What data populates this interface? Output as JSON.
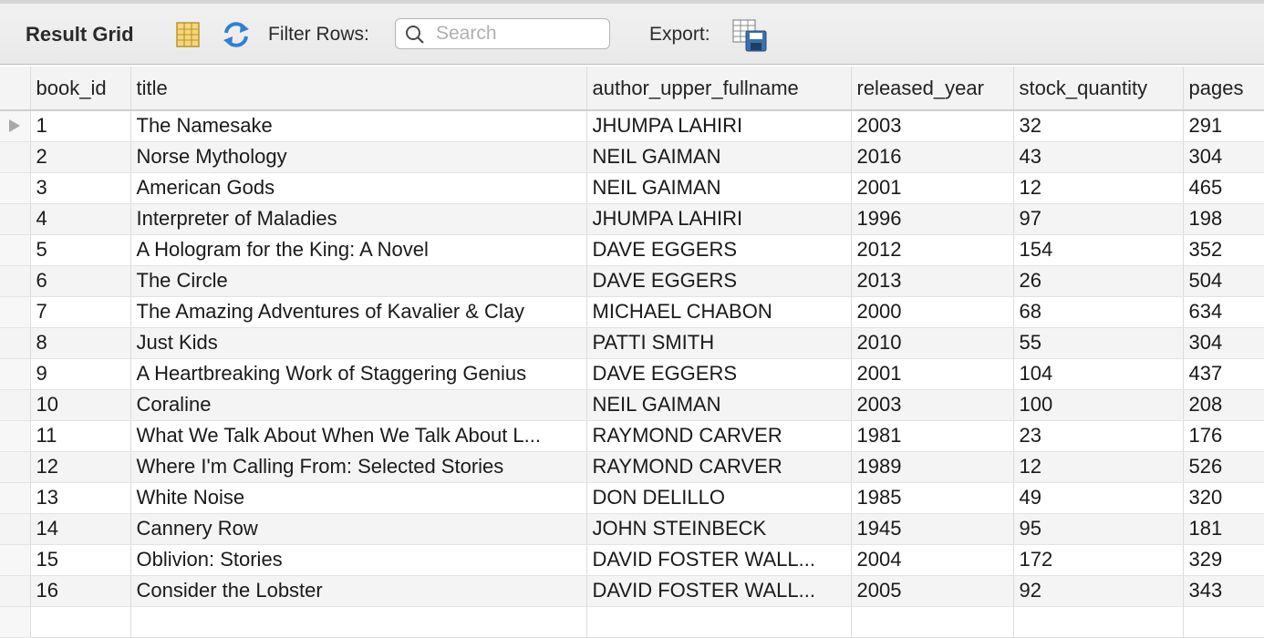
{
  "toolbar": {
    "title": "Result Grid",
    "filter_label": "Filter Rows:",
    "search_placeholder": "Search",
    "search_value": "",
    "export_label": "Export:",
    "icons": [
      "form-editor-icon",
      "refresh-icon",
      "search-icon",
      "export-icon"
    ]
  },
  "grid": {
    "columns": [
      "book_id",
      "title",
      "author_upper_fullname",
      "released_year",
      "stock_quantity",
      "pages"
    ],
    "rows": [
      [
        "1",
        "The Namesake",
        "JHUMPA LAHIRI",
        "2003",
        "32",
        "291"
      ],
      [
        "2",
        "Norse Mythology",
        "NEIL GAIMAN",
        "2016",
        "43",
        "304"
      ],
      [
        "3",
        "American Gods",
        "NEIL GAIMAN",
        "2001",
        "12",
        "465"
      ],
      [
        "4",
        "Interpreter of Maladies",
        "JHUMPA LAHIRI",
        "1996",
        "97",
        "198"
      ],
      [
        "5",
        "A Hologram for the King: A Novel",
        "DAVE EGGERS",
        "2012",
        "154",
        "352"
      ],
      [
        "6",
        "The Circle",
        "DAVE EGGERS",
        "2013",
        "26",
        "504"
      ],
      [
        "7",
        "The Amazing Adventures of Kavalier & Clay",
        "MICHAEL CHABON",
        "2000",
        "68",
        "634"
      ],
      [
        "8",
        "Just Kids",
        "PATTI SMITH",
        "2010",
        "55",
        "304"
      ],
      [
        "9",
        "A Heartbreaking Work of Staggering Genius",
        "DAVE EGGERS",
        "2001",
        "104",
        "437"
      ],
      [
        "10",
        "Coraline",
        "NEIL GAIMAN",
        "2003",
        "100",
        "208"
      ],
      [
        "11",
        "What We Talk About When We Talk About L...",
        "RAYMOND CARVER",
        "1981",
        "23",
        "176"
      ],
      [
        "12",
        "Where I'm Calling From: Selected Stories",
        "RAYMOND CARVER",
        "1989",
        "12",
        "526"
      ],
      [
        "13",
        "White Noise",
        "DON DELILLO",
        "1985",
        "49",
        "320"
      ],
      [
        "14",
        "Cannery Row",
        "JOHN STEINBECK",
        "1945",
        "95",
        "181"
      ],
      [
        "15",
        "Oblivion: Stories",
        "DAVID FOSTER WALL...",
        "2004",
        "172",
        "329"
      ],
      [
        "16",
        "Consider the Lobster",
        "DAVID FOSTER WALL...",
        "2005",
        "92",
        "343"
      ]
    ],
    "selected_row": 0
  }
}
